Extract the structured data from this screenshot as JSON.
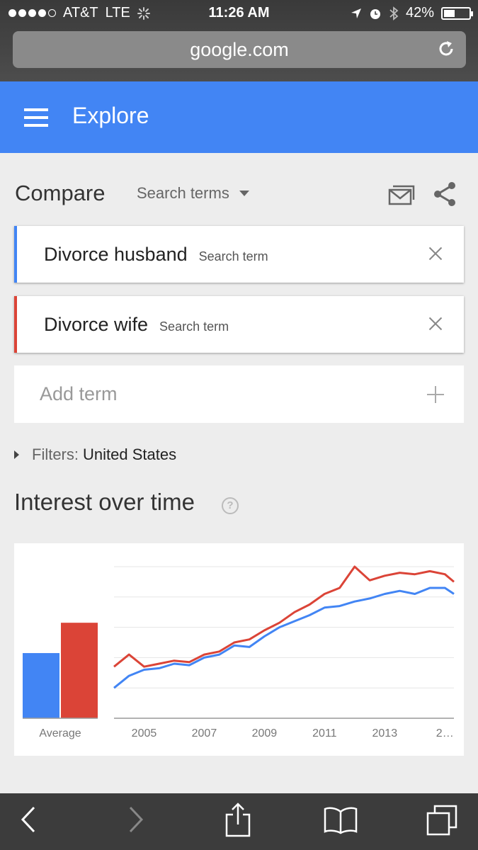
{
  "status_bar": {
    "carrier": "AT&T",
    "network": "LTE",
    "time": "11:26 AM",
    "battery": "42%",
    "battery_level": 0.42
  },
  "browser": {
    "url": "google.com"
  },
  "header": {
    "title": "Explore"
  },
  "compare": {
    "label": "Compare",
    "dropdown_label": "Search terms",
    "terms": [
      {
        "name": "Divorce husband",
        "sub": "Search term",
        "color": "#4285f4"
      },
      {
        "name": "Divorce wife",
        "sub": "Search term",
        "color": "#db4437"
      }
    ],
    "add_placeholder": "Add term"
  },
  "filters": {
    "label": "Filters:",
    "value": "United States"
  },
  "interest": {
    "title": "Interest over time",
    "help": "?"
  },
  "chart_data": {
    "type": "line",
    "average": {
      "label": "Average",
      "values": [
        43,
        63
      ]
    },
    "x_tick_labels": [
      "2005",
      "2007",
      "2009",
      "2011",
      "2013",
      "2…"
    ],
    "xlim": [
      2004.0,
      2015.3
    ],
    "ylim": [
      0,
      100
    ],
    "grid": true,
    "series": [
      {
        "color": "#4285f4",
        "points": [
          [
            2004.0,
            20
          ],
          [
            2004.5,
            28
          ],
          [
            2005.0,
            32
          ],
          [
            2005.5,
            33
          ],
          [
            2006.0,
            36
          ],
          [
            2006.5,
            35
          ],
          [
            2007.0,
            40
          ],
          [
            2007.5,
            42
          ],
          [
            2008.0,
            48
          ],
          [
            2008.5,
            47
          ],
          [
            2009.0,
            54
          ],
          [
            2009.5,
            60
          ],
          [
            2010.0,
            64
          ],
          [
            2010.5,
            68
          ],
          [
            2011.0,
            73
          ],
          [
            2011.5,
            74
          ],
          [
            2012.0,
            77
          ],
          [
            2012.5,
            79
          ],
          [
            2013.0,
            82
          ],
          [
            2013.5,
            84
          ],
          [
            2014.0,
            82
          ],
          [
            2014.5,
            86
          ],
          [
            2015.0,
            86
          ],
          [
            2015.3,
            82
          ]
        ]
      },
      {
        "color": "#db4437",
        "points": [
          [
            2004.0,
            34
          ],
          [
            2004.5,
            42
          ],
          [
            2005.0,
            34
          ],
          [
            2005.5,
            36
          ],
          [
            2006.0,
            38
          ],
          [
            2006.5,
            37
          ],
          [
            2007.0,
            42
          ],
          [
            2007.5,
            44
          ],
          [
            2008.0,
            50
          ],
          [
            2008.5,
            52
          ],
          [
            2009.0,
            58
          ],
          [
            2009.5,
            63
          ],
          [
            2010.0,
            70
          ],
          [
            2010.5,
            75
          ],
          [
            2011.0,
            82
          ],
          [
            2011.5,
            86
          ],
          [
            2012.0,
            100
          ],
          [
            2012.5,
            91
          ],
          [
            2013.0,
            94
          ],
          [
            2013.5,
            96
          ],
          [
            2014.0,
            95
          ],
          [
            2014.5,
            97
          ],
          [
            2015.0,
            95
          ],
          [
            2015.3,
            90
          ]
        ]
      }
    ]
  }
}
